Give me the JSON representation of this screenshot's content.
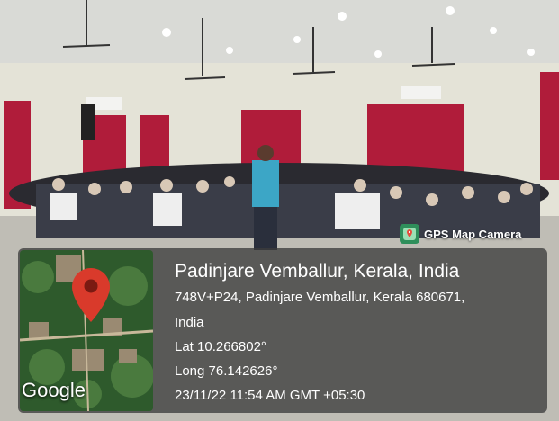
{
  "badge": {
    "label": "GPS Map Camera"
  },
  "info": {
    "title": "Padinjare Vemballur, Kerala, India",
    "address_line1": "748V+P24, Padinjare Vemballur, Kerala 680671,",
    "address_line2": "India",
    "lat": "Lat 10.266802°",
    "long": "Long 76.142626°",
    "datetime": "23/11/22 11:54 AM GMT +05:30"
  },
  "map": {
    "provider_label": "Google",
    "pin_color": "#d93a2b"
  }
}
